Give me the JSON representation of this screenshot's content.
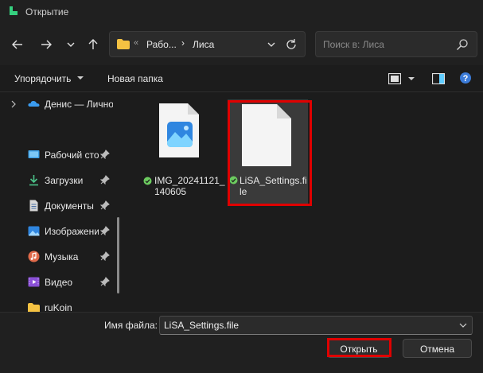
{
  "window": {
    "title": "Открытие"
  },
  "address": {
    "segments": [
      "Рабо...",
      "Лиса"
    ],
    "overflow": "«",
    "separator": "›"
  },
  "search": {
    "placeholder": "Поиск в: Лиса"
  },
  "toolbar": {
    "organize_label": "Упорядочить",
    "new_folder_label": "Новая папка"
  },
  "sidebar": {
    "top_item": "Денис — Личное",
    "items": [
      {
        "label": "Рабочий стол",
        "icon": "desktop-icon"
      },
      {
        "label": "Загрузки",
        "icon": "download-icon"
      },
      {
        "label": "Документы",
        "icon": "documents-icon"
      },
      {
        "label": "Изображения",
        "icon": "pictures-icon"
      },
      {
        "label": "Музыка",
        "icon": "music-icon"
      },
      {
        "label": "Видео",
        "icon": "video-icon"
      },
      {
        "label": "ruKoin",
        "icon": "folder-icon"
      }
    ]
  },
  "files": [
    {
      "name_line1": "IMG_20241121_",
      "name_line2": "140605",
      "type": "image",
      "sync": "synced"
    },
    {
      "name_line1": "LiSA_Settings.fi",
      "name_line2": "le",
      "type": "file",
      "sync": "synced",
      "selected": true
    }
  ],
  "footer": {
    "file_name_label": "Имя файла:",
    "file_name_value": "LiSA_Settings.file",
    "open_label": "Открыть",
    "cancel_label": "Отмена"
  },
  "colors": {
    "highlight": "#e00000",
    "accent": "#60cdff",
    "folder": "#f5c242",
    "sync_ok": "#6ccb5f"
  }
}
